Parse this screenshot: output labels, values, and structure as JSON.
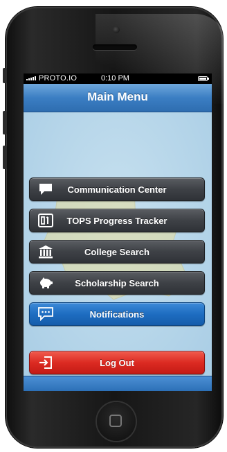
{
  "status_bar": {
    "carrier": "PROTO.IO",
    "time": "0:10 PM"
  },
  "nav": {
    "title": "Main Menu"
  },
  "menu": {
    "items": [
      {
        "label": "Communication Center",
        "icon": "speech-bubble-icon"
      },
      {
        "label": "TOPS Progress Tracker",
        "icon": "scoreboard-icon"
      },
      {
        "label": "College Search",
        "icon": "building-icon"
      },
      {
        "label": "Scholarship Search",
        "icon": "piggy-bank-icon"
      },
      {
        "label": "Notifications",
        "icon": "chat-dots-icon"
      }
    ],
    "logout": {
      "label": "Log Out",
      "icon": "logout-icon"
    }
  },
  "colors": {
    "navbar": "#3b7ec3",
    "menu_button": "#3e4146",
    "notifications_button": "#1e6dc1",
    "logout_button": "#dc2b22",
    "background": "#b8d7ea"
  }
}
